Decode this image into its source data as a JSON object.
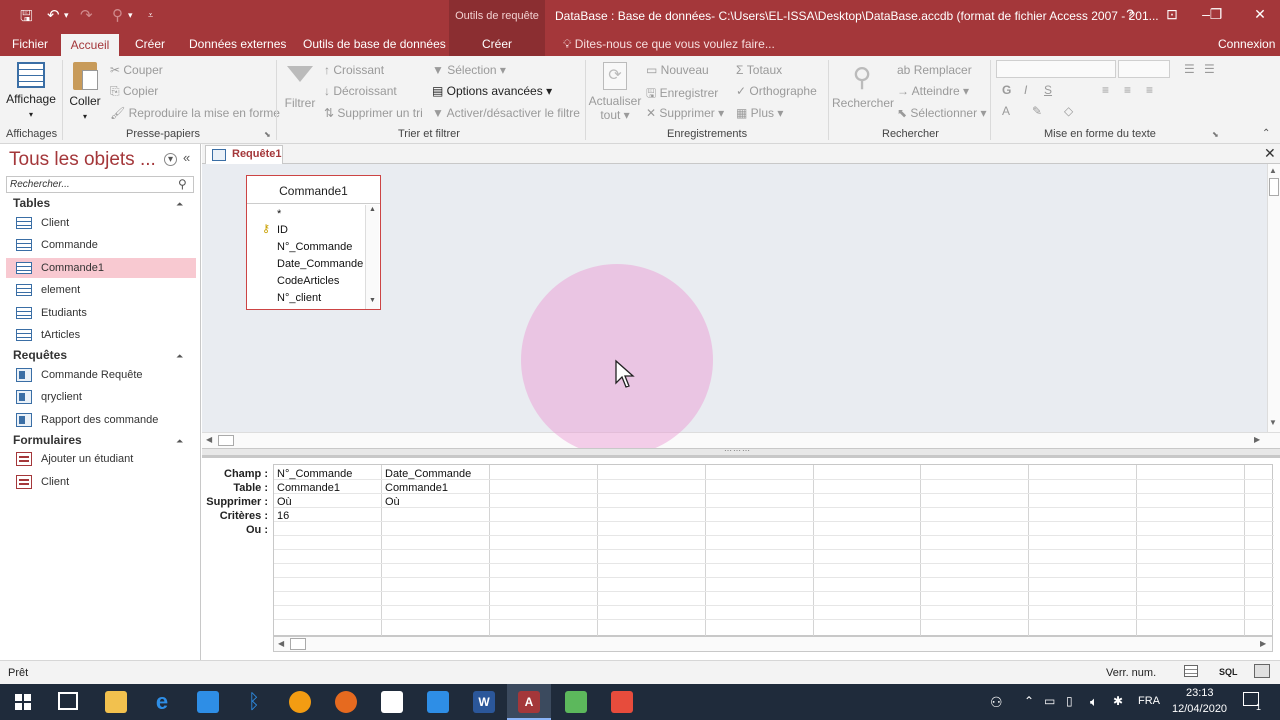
{
  "titlebar": {
    "context_title": "Outils de requête",
    "document_title": "DataBase : Base de données- C:\\Users\\EL-ISSA\\Desktop\\DataBase.accdb (format de fichier Access 2007 - 201...",
    "help": "?"
  },
  "tabs": {
    "fichier": "Fichier",
    "accueil": "Accueil",
    "creer": "Créer",
    "donnees_externes": "Données externes",
    "outils_bd": "Outils de base de données",
    "creer_ctx": "Créer",
    "tell_me": "Dites-nous ce que vous voulez faire...",
    "connexion": "Connexion"
  },
  "ribbon": {
    "affichage": "Affichage",
    "coller": "Coller",
    "couper": "Couper",
    "copier": "Copier",
    "reproduire": "Reproduire la mise en forme",
    "filtrer": "Filtrer",
    "croissant": "Croissant",
    "decroissant": "Décroissant",
    "supprimer_tri": "Supprimer un tri",
    "selection": "Sélection",
    "options_avancees": "Options avancées",
    "activer_filtre": "Activer/désactiver le filtre",
    "actualiser": "Actualiser",
    "tout": "tout",
    "nouveau": "Nouveau",
    "enregistrer": "Enregistrer",
    "supprimer": "Supprimer",
    "totaux": "Totaux",
    "orthographe": "Orthographe",
    "plus": "Plus",
    "rechercher": "Rechercher",
    "remplacer": "Remplacer",
    "atteindre": "Atteindre",
    "selectionner": "Sélectionner",
    "g": "G",
    "i": "I",
    "s": "S",
    "a": "A",
    "groups": {
      "affichages": "Affichages",
      "presse_papiers": "Presse-papiers",
      "trier_filtrer": "Trier et filtrer",
      "enregistrements": "Enregistrements",
      "rechercher": "Rechercher",
      "mise_en_forme": "Mise en forme du texte"
    }
  },
  "nav": {
    "title": "Tous les objets ...",
    "search_placeholder": "Rechercher...",
    "sections": {
      "tables": "Tables",
      "requetes": "Requêtes",
      "formulaires": "Formulaires"
    },
    "tables": [
      "Client",
      "Commande",
      "Commande1",
      "element",
      "Etudiants",
      "tArticles"
    ],
    "requetes": [
      "Commande Requête",
      "qryclient",
      "Rapport des commande"
    ],
    "formulaires": [
      "Ajouter un étudiant",
      "Client"
    ]
  },
  "doc": {
    "tab_label": "Requête1",
    "close": "✕"
  },
  "table_box": {
    "title": "Commande1",
    "fields": [
      "*",
      "ID",
      "N°_Commande",
      "Date_Commande",
      "CodeArticles",
      "N°_client"
    ]
  },
  "grid": {
    "row_labels": [
      "Champ :",
      "Table :",
      "Supprimer :",
      "Critères :",
      "Ou :"
    ],
    "columns": [
      {
        "champ": "N°_Commande",
        "table": "Commande1",
        "supprimer": "Où",
        "criteres": "16"
      },
      {
        "champ": "Date_Commande",
        "table": "Commande1",
        "supprimer": "Où",
        "criteres": ""
      }
    ]
  },
  "status": {
    "left": "Prêt",
    "verr": "Verr. num.",
    "sql": "SQL"
  },
  "taskbar": {
    "lang": "FRA",
    "time": "23:13",
    "date": "12/04/2020",
    "notif_count": "1"
  },
  "colors": {
    "accent": "#a4373a",
    "selected_nav": "#f8c9d1",
    "design_bg": "#e9ecf1"
  }
}
